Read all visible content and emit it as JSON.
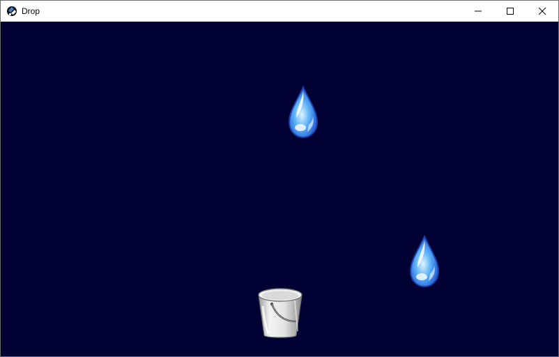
{
  "window": {
    "title": "Drop",
    "icon": "app-icon",
    "controls": [
      "minimize-icon",
      "maximize-icon",
      "close-icon"
    ]
  },
  "game": {
    "background_color": "#000033",
    "sprites": [
      {
        "name": "raindrop",
        "icon": "water-drop"
      },
      {
        "name": "raindrop",
        "icon": "water-drop"
      },
      {
        "name": "bucket",
        "icon": "bucket"
      }
    ]
  }
}
